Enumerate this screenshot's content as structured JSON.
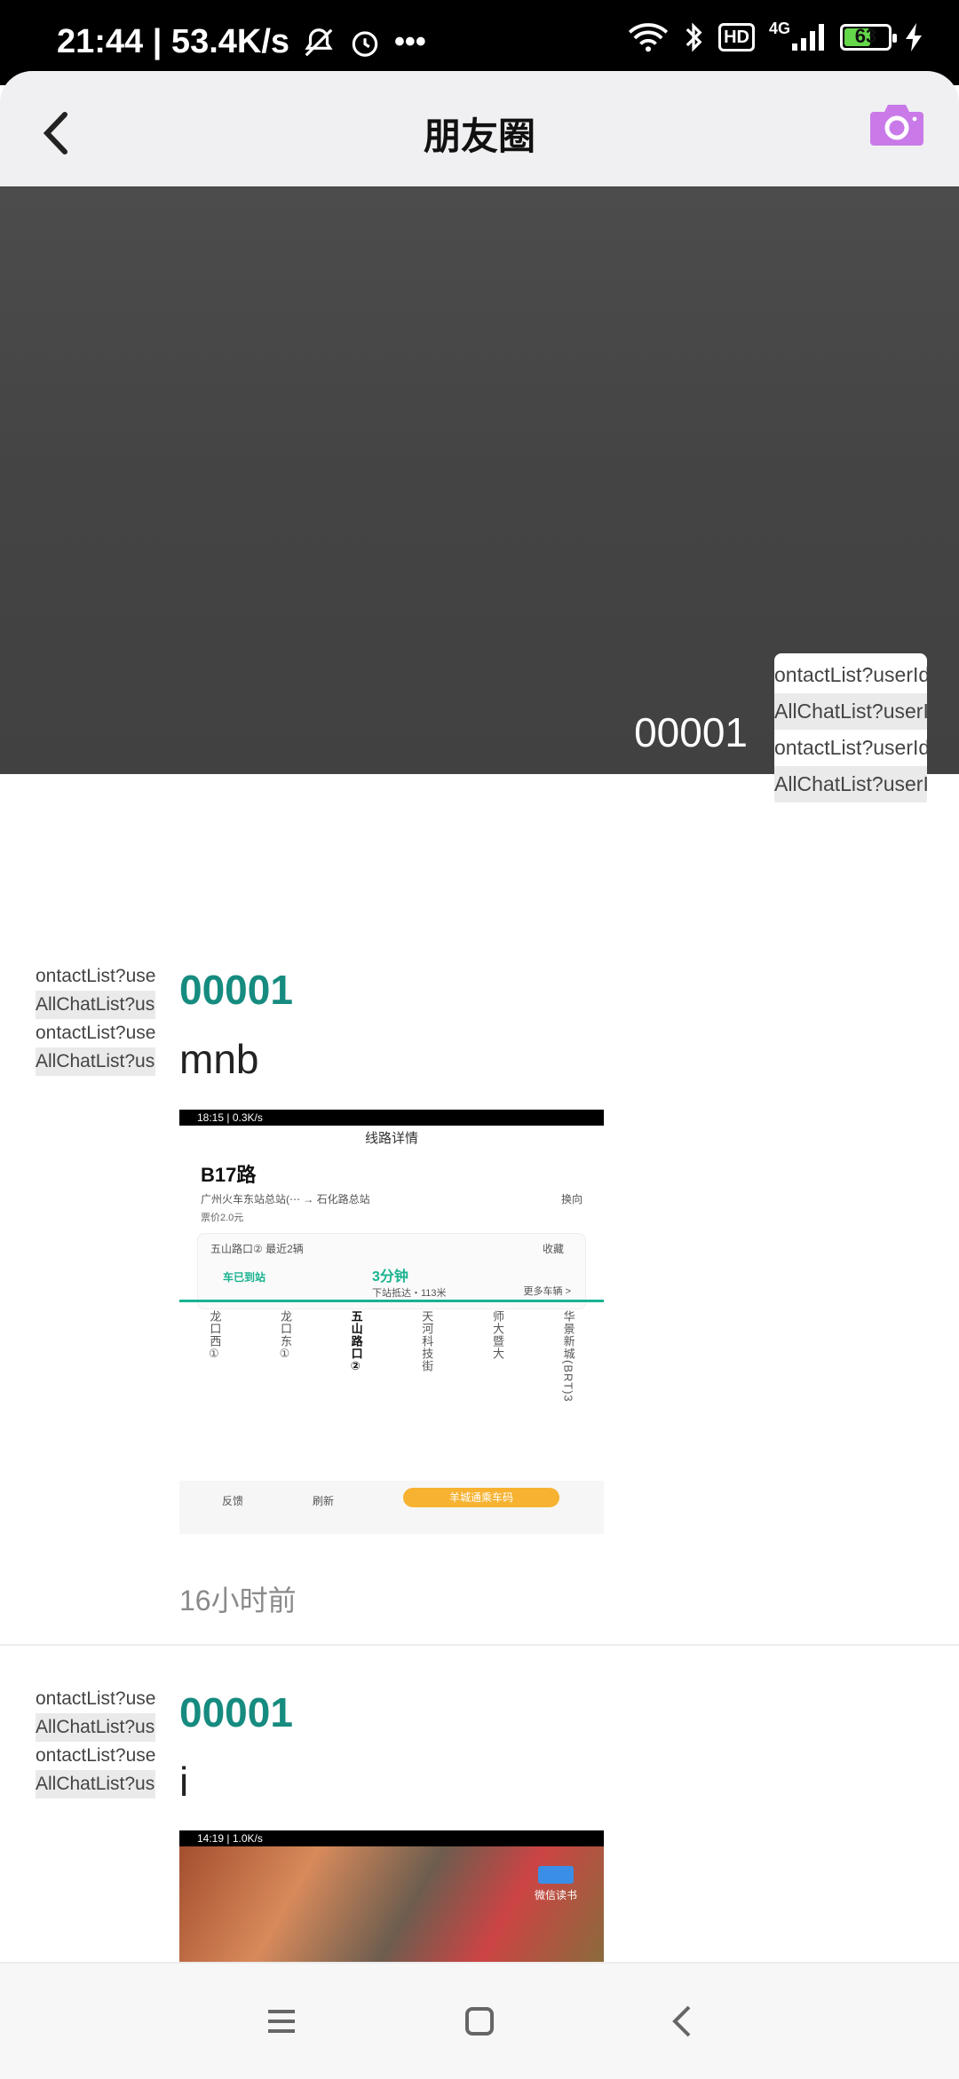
{
  "status_bar": {
    "time_speed": "21:44 | 53.4K/s",
    "network": "4G",
    "hd": "HD",
    "battery": "63",
    "battery_level": 0.63
  },
  "header": {
    "title": "朋友圈",
    "back_icon": "chevron-left-icon",
    "camera_icon": "camera-icon",
    "accent_color": "#c97ae8"
  },
  "cover": {
    "user_name": "00001",
    "avatar_lines": [
      "ontactList?userId",
      "AllChatList?userI",
      "ontactList?userId",
      "AllChatList?userI"
    ]
  },
  "posts": [
    {
      "avatar_lines": [
        "ontactList?userId",
        "AllChatList?userI",
        "ontactList?userId",
        "AllChatList?userI"
      ],
      "name": "00001",
      "text": "mnb",
      "time": "16小时前",
      "image": {
        "status": "18:15 | 0.3K/s",
        "page_title": "线路详情",
        "route": "B17路",
        "route_desc": "广州火车东站总站(⋯ → 石化路总站",
        "direction": "换向",
        "fare": "票价2.0元",
        "station_label": "五山路口② 最近2辆",
        "favorite": "收藏",
        "arrived": "车已到站",
        "eta": "3分钟",
        "next_stop": "下站抵达・113米",
        "more": "更多车辆 >",
        "stops": [
          "龙口西①",
          "龙口东①",
          "五山路口②",
          "天河科技街",
          "师大暨大",
          "华景新城(BRT)3"
        ],
        "current_stop_index": 2,
        "feedback": "反馈",
        "refresh": "刷新",
        "button": "羊城通乘车码"
      }
    },
    {
      "avatar_lines": [
        "ontactList?userId",
        "AllChatList?userI",
        "ontactList?userId",
        "AllChatList?userI"
      ],
      "name": "00001",
      "text": "i",
      "image": {
        "status": "14:19 | 1.0K/s",
        "label": "微信读书"
      }
    }
  ],
  "nav": {
    "menu_icon": "menu-icon",
    "home_icon": "home-square-icon",
    "back_icon": "back-triangle-icon"
  }
}
